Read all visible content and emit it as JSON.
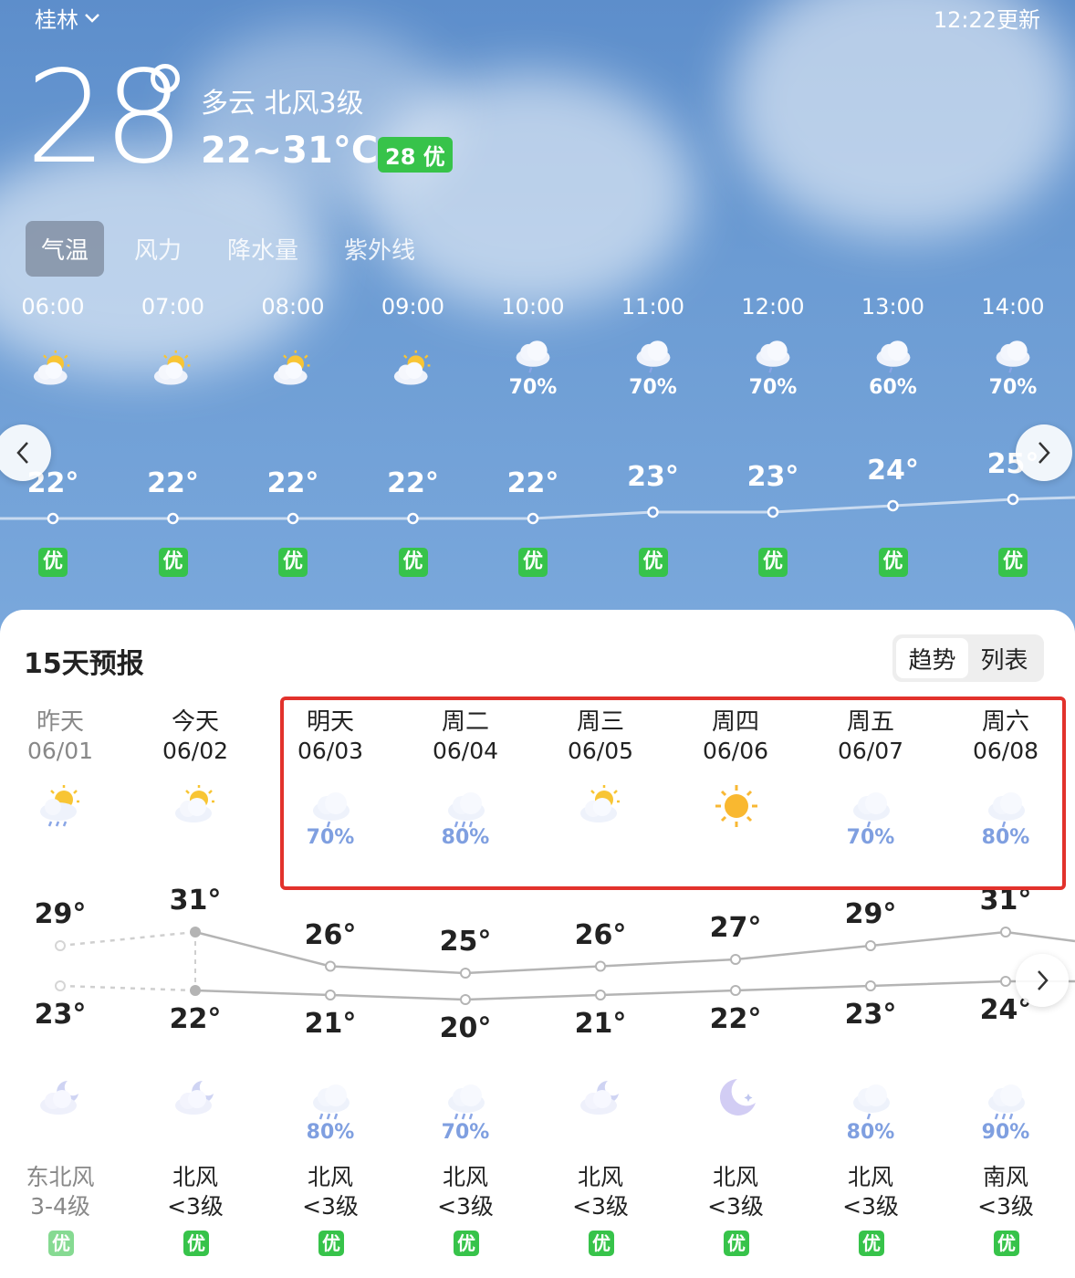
{
  "header": {
    "city": "桂林",
    "updated": "12:22更新"
  },
  "current": {
    "temp": "28",
    "condition": "多云  北风3级",
    "range": "22~31°C",
    "aqi": "28 优"
  },
  "tabs": [
    {
      "label": "气温",
      "active": true
    },
    {
      "label": "风力",
      "active": false
    },
    {
      "label": "降水量",
      "active": false
    },
    {
      "label": "紫外线",
      "active": false
    }
  ],
  "hourly": [
    {
      "time": "06:00",
      "icon": "partly-sunny-icon",
      "precip": "",
      "temp": "22°",
      "aqi": "优"
    },
    {
      "time": "07:00",
      "icon": "partly-sunny-icon",
      "precip": "",
      "temp": "22°",
      "aqi": "优"
    },
    {
      "time": "08:00",
      "icon": "partly-sunny-icon",
      "precip": "",
      "temp": "22°",
      "aqi": "优"
    },
    {
      "time": "09:00",
      "icon": "partly-sunny-icon",
      "precip": "",
      "temp": "22°",
      "aqi": "优"
    },
    {
      "time": "10:00",
      "icon": "light-rain-icon",
      "precip": "70%",
      "temp": "22°",
      "aqi": "优"
    },
    {
      "time": "11:00",
      "icon": "light-rain-icon",
      "precip": "70%",
      "temp": "23°",
      "aqi": "优"
    },
    {
      "time": "12:00",
      "icon": "light-rain-icon",
      "precip": "70%",
      "temp": "23°",
      "aqi": "优"
    },
    {
      "time": "13:00",
      "icon": "light-rain-icon",
      "precip": "60%",
      "temp": "24°",
      "aqi": "优"
    },
    {
      "time": "14:00",
      "icon": "light-rain-icon",
      "precip": "70%",
      "temp": "25°",
      "aqi": "优"
    }
  ],
  "forecast": {
    "title": "15天预报",
    "toggle": [
      "趋势",
      "列表"
    ],
    "days": [
      {
        "name": "昨天",
        "date": "06/01",
        "icon": "sun-rain-icon",
        "precip": "",
        "high": "29°",
        "low": "23°",
        "night_icon": "cloudy-night-icon",
        "night_precip": "",
        "wind_dir": "东北风",
        "wind_level": "3-4级",
        "aqi": "优"
      },
      {
        "name": "今天",
        "date": "06/02",
        "icon": "partly-sunny-icon",
        "precip": "",
        "high": "31°",
        "low": "22°",
        "night_icon": "cloudy-night-icon",
        "night_precip": "",
        "wind_dir": "北风",
        "wind_level": "<3级",
        "aqi": "优"
      },
      {
        "name": "明天",
        "date": "06/03",
        "icon": "light-rain-icon",
        "precip": "70%",
        "high": "26°",
        "low": "21°",
        "night_icon": "moderate-rain-icon",
        "night_precip": "80%",
        "wind_dir": "北风",
        "wind_level": "<3级",
        "aqi": "优"
      },
      {
        "name": "周二",
        "date": "06/04",
        "icon": "moderate-rain-icon",
        "precip": "80%",
        "high": "25°",
        "low": "20°",
        "night_icon": "moderate-rain-icon",
        "night_precip": "70%",
        "wind_dir": "北风",
        "wind_level": "<3级",
        "aqi": "优"
      },
      {
        "name": "周三",
        "date": "06/05",
        "icon": "partly-sunny-icon",
        "precip": "",
        "high": "26°",
        "low": "21°",
        "night_icon": "cloudy-night-icon",
        "night_precip": "",
        "wind_dir": "北风",
        "wind_level": "<3级",
        "aqi": "优"
      },
      {
        "name": "周四",
        "date": "06/06",
        "icon": "sunny-icon",
        "precip": "",
        "high": "27°",
        "low": "22°",
        "night_icon": "clear-night-icon",
        "night_precip": "",
        "wind_dir": "北风",
        "wind_level": "<3级",
        "aqi": "优"
      },
      {
        "name": "周五",
        "date": "06/07",
        "icon": "light-rain-icon",
        "precip": "70%",
        "high": "29°",
        "low": "23°",
        "night_icon": "light-rain-icon",
        "night_precip": "80%",
        "wind_dir": "北风",
        "wind_level": "<3级",
        "aqi": "优"
      },
      {
        "name": "周六",
        "date": "06/08",
        "icon": "light-rain-icon",
        "precip": "80%",
        "high": "31°",
        "low": "24°",
        "night_icon": "moderate-rain-icon",
        "night_precip": "90%",
        "wind_dir": "南风",
        "wind_level": "<3级",
        "aqi": "优"
      }
    ]
  },
  "colors": {
    "aqi_good": "#37c34a",
    "highlight_box": "#e2322c",
    "precip_text": "#7f9fe0",
    "sky_top": "#5d8ecb"
  }
}
